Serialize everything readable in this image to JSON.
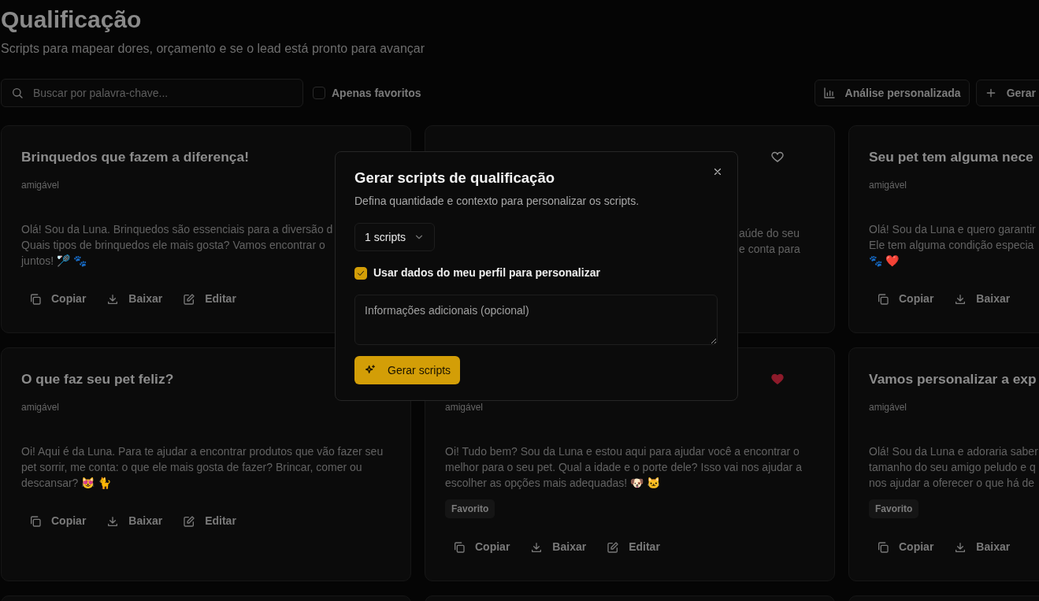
{
  "page": {
    "title": "Qualificação",
    "subtitle": "Scripts para mapear dores, orçamento e se o lead está pronto para avançar"
  },
  "toolbar": {
    "search": {
      "placeholder": "Buscar por palavra-chave..."
    },
    "favorites_filter": {
      "label": "Apenas favoritos",
      "checked": false
    },
    "buttons": [
      {
        "label": "Análise personalizada",
        "kind": "chart"
      },
      {
        "label": "Gerar",
        "kind": "add"
      }
    ]
  },
  "cards": [
    {
      "kind": "script",
      "title": "Brinquedos que fazem a diferença!",
      "tone": "amigável",
      "body": [
        "Olá! Sou da Luna. Brinquedos são essenciais para a diversão d",
        "Quais tipos de brinquedos ele mais gosta? Vamos encontrar o",
        "juntos! 🏸 🐾"
      ],
      "actions": [
        {
          "label": "Copiar",
          "kind": "copy"
        },
        {
          "label": "Baixar",
          "kind": "download"
        },
        {
          "label": "Editar",
          "kind": "edit"
        }
      ]
    },
    {
      "kind": "partly_covered",
      "favorite": false,
      "body": [
        "aúde do seu",
        "e conta para"
      ]
    },
    {
      "kind": "script",
      "title": "Seu pet tem alguma nece",
      "tone": "amigável",
      "body": [
        "Olá! Sou da Luna e quero garantir",
        "Ele tem alguma condição especia",
        "🐾 ❤️"
      ],
      "actions": [
        {
          "label": "Copiar",
          "kind": "copy"
        },
        {
          "label": "Baixar",
          "kind": "download"
        }
      ]
    },
    {
      "kind": "script",
      "title": "O que faz seu pet feliz?",
      "tone": "amigável",
      "body": [
        "Oi! Aqui é da Luna. Para te ajudar a encontrar produtos que vão fazer seu",
        "pet sorrir, me conta: o que ele mais gosta de fazer? Brincar, comer ou",
        "descansar? 😻 🐈"
      ],
      "actions": [
        {
          "label": "Copiar",
          "kind": "copy"
        },
        {
          "label": "Baixar",
          "kind": "download"
        },
        {
          "label": "Editar",
          "kind": "edit"
        }
      ]
    },
    {
      "kind": "script",
      "favorite": true,
      "tone": "amigável",
      "body": [
        "Oi! Tudo bem? Sou da Luna e estou aqui para ajudar você a encontrar o",
        "melhor para o seu pet. Qual a idade e o porte dele? Isso vai nos ajudar a",
        "escolher as opções mais adequadas! 🐶 🐱"
      ],
      "tag": "Favorito",
      "actions": [
        {
          "label": "Copiar",
          "kind": "copy"
        },
        {
          "label": "Baixar",
          "kind": "download"
        },
        {
          "label": "Editar",
          "kind": "edit"
        }
      ]
    },
    {
      "kind": "script",
      "title": "Vamos personalizar a exp",
      "tone": "amigável",
      "body": [
        "Olá! Sou da Luna e adoraria saber",
        "tamanho do seu amigo peludo e q",
        "nos ajudar a oferecer o que há de"
      ],
      "tag": "Favorito",
      "actions": [
        {
          "label": "Copiar",
          "kind": "copy"
        },
        {
          "label": "Baixar",
          "kind": "download"
        }
      ]
    },
    {
      "kind": "empty"
    },
    {
      "kind": "empty"
    },
    {
      "kind": "empty"
    }
  ],
  "dialog": {
    "title": "Gerar scripts de qualificação",
    "description": "Defina quantidade e contexto para personalizar os scripts.",
    "quantity": "1 scripts",
    "use_profile": {
      "label": "Usar dados do meu perfil para personalizar",
      "checked": true
    },
    "notes": {
      "placeholder": "Informações adicionais (opcional)"
    },
    "submit": "Gerar scripts"
  }
}
